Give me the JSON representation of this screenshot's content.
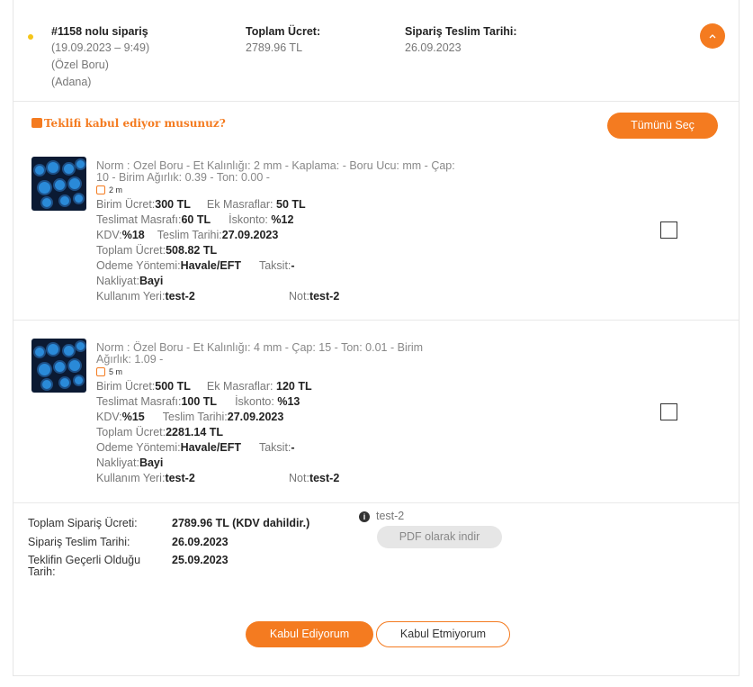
{
  "order": {
    "number": "#1158 nolu sipariş",
    "datetime": "(19.09.2023 – 9:49)",
    "category": "(Özel Boru)",
    "city": "(Adana)",
    "total_label": "Toplam Ücret:",
    "total_value": "2789.96 TL",
    "delivery_label": "Sipariş Teslim Tarihi:",
    "delivery_value": "26.09.2023",
    "collapse_icon": "chevron-up-icon",
    "status_color": "#f5c518"
  },
  "offer": {
    "question": "Teklifi kabul ediyor musunuz?",
    "question_icon": "offer-icon",
    "select_all": "Tümünü Seç"
  },
  "labels": {
    "unit_price": "Birim Ücret:",
    "extra_costs": "Ek Masraflar:",
    "shipping_cost": "Teslimat Masrafı:",
    "discount": "İskonto:",
    "vat": "KDV:",
    "delivery_date": "Teslim Tarihi:",
    "total": "Toplam Ücret:",
    "payment": "Odeme Yöntemi:",
    "installment": "Taksit:",
    "transport": "Nakliyat:",
    "usage": "Kullanım Yeri:",
    "note": "Not:"
  },
  "items": [
    {
      "desc": "Norm : Ozel Boru - Et Kalınlığı: 2 mm - Kaplama: - Boru Ucu: mm - Çap: 10 - Birim Ağırlık: 0.39 - Ton: 0.00 -",
      "length": "2 m",
      "unit_price": "300 TL",
      "extra_costs": "50 TL",
      "shipping_cost": "60 TL",
      "discount": "%12",
      "vat": "%18",
      "delivery_date": "27.09.2023",
      "total": "508.82 TL",
      "payment": "Havale/EFT",
      "installment": "-",
      "transport": "Bayi",
      "usage": "test-2",
      "note": "test-2",
      "checked": false
    },
    {
      "desc": "Norm : Özel Boru - Et Kalınlığı: 4 mm - Çap: 15 - Ton: 0.01 - Birim Ağırlık: 1.09 -",
      "length": "5 m",
      "unit_price": "500 TL",
      "extra_costs": "120 TL",
      "shipping_cost": "100 TL",
      "discount": "%13",
      "vat": "%15",
      "delivery_date": "27.09.2023",
      "total": "2281.14 TL",
      "payment": "Havale/EFT",
      "installment": "-",
      "transport": "Bayi",
      "usage": "test-2",
      "note": "test-2",
      "checked": false
    }
  ],
  "summary": {
    "total_label": "Toplam Sipariş Ücreti:",
    "total_value": "2789.96 TL (KDV dahildir.)",
    "delivery_label": "Sipariş Teslim Tarihi:",
    "delivery_value": "26.09.2023",
    "valid_label_1": "Teklifin Geçerli Olduğu",
    "valid_label_2": "Tarih:",
    "valid_value": "25.09.2023",
    "info_text": "test-2",
    "pdf_button": "PDF olarak indir"
  },
  "actions": {
    "accept": "Kabul Ediyorum",
    "reject": "Kabul Etmiyorum",
    "accent_color": "#f47b20"
  }
}
